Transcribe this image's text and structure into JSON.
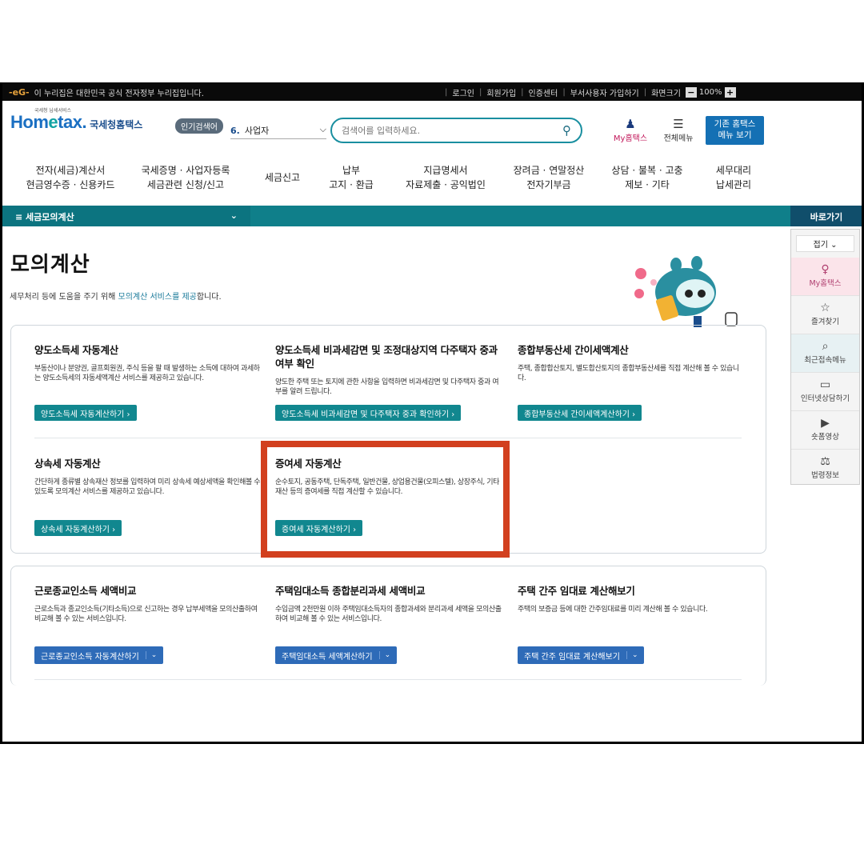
{
  "govbar": {
    "logo": "-eG-",
    "notice": "이 누리집은 대한민국 공식 전자정부 누리집입니다.",
    "links": [
      "로그인",
      "회원가입",
      "인증센터",
      "부서사용자 가입하기",
      "화면크기"
    ],
    "zoom_minus": "−",
    "zoom_value": "100%",
    "zoom_plus": "+"
  },
  "header": {
    "logo_tiny": "국세청 납세서비스",
    "logo_brand_a": "Hom",
    "logo_brand_b": "e",
    "logo_brand_c": "tax.",
    "logo_sub": "국세청홈택스",
    "popular_label": "인기검색어",
    "trend_num": "6.",
    "trend_text": "사업자",
    "trend_arrow": "⌵",
    "search_placeholder": "검색어를 입력하세요.",
    "my_label": "My홈택스",
    "menu_label": "전체메뉴",
    "old_home_line1": "기존 홈택스",
    "old_home_line2": "메뉴 보기"
  },
  "nav": [
    {
      "l1": "전자(세금)계산서",
      "l2": "현금영수증 · 신용카드"
    },
    {
      "l1": "국세증명 · 사업자등록",
      "l2": "세금관련 신청/신고"
    },
    {
      "l1": "세금신고",
      "l2": ""
    },
    {
      "l1": "납부",
      "l2": "고지 · 환급"
    },
    {
      "l1": "지급명세서",
      "l2": "자료제출 · 공익법인"
    },
    {
      "l1": "장려금 · 연말정산",
      "l2": "전자기부금"
    },
    {
      "l1": "상담 · 불복 · 고충",
      "l2": "제보 · 기타"
    },
    {
      "l1": "세무대리",
      "l2": "납세관리"
    }
  ],
  "section": {
    "menu_label": "≡  세금모의계산",
    "menu_arrow": "⌄",
    "quick_title": "바로가기"
  },
  "quick": {
    "fold": "접기 ⌄",
    "items": [
      {
        "icon": "♀",
        "label": "My홈택스"
      },
      {
        "icon": "☆",
        "label": "즐겨찾기"
      },
      {
        "icon": "⌕",
        "label": "최근접속메뉴"
      },
      {
        "icon": "▭",
        "label": "인터넷상담하기"
      },
      {
        "icon": "▶",
        "label": "숏폼영상"
      },
      {
        "icon": "⚖",
        "label": "법령정보"
      }
    ]
  },
  "page": {
    "title": "모의계산",
    "desc_a": "세무처리 등에 도움을 주기 위해 ",
    "desc_hl": "모의계산 서비스를 제공",
    "desc_b": "합니다."
  },
  "calcs": [
    {
      "title": "양도소득세 자동계산",
      "desc": "부동산이나 분양권, 골프회원권, 주식 등을 팔 때 발생하는 소득에 대하여 과세하는 양도소득세의 자동세액계산 서비스를 제공하고 있습니다.",
      "button": "양도소득세 자동계산하기  ›"
    },
    {
      "title": "양도소득세 비과세감면 및 조정대상지역 다주택자 중과 여부 확인",
      "desc": "양도한 주택 또는 토지에 관한 사항을 입력하면 비과세감면 및 다주택자 중과 여부를 알려 드립니다.",
      "button": "양도소득세 비과세감면 및 다주택자 중과 확인하기  ›"
    },
    {
      "title": "종합부동산세 간이세액계산",
      "desc": "주택, 종합합산토지, 별도합산토지의 종합부동산세를 직접 계산해 볼 수 있습니다.",
      "button": "종합부동산세 간이세액계산하기  ›"
    },
    {
      "title": "상속세 자동계산",
      "desc": "간단하게 종류별 상속재산 정보를 입력하여 미리 상속세 예상세액을 확인해볼 수 있도록 모의계산 서비스를 제공하고 있습니다.",
      "button": "상속세 자동계산하기  ›"
    },
    {
      "title": "증여세 자동계산",
      "desc": "순수토지, 공동주택, 단독주택, 일반건물, 상업용건물(오피스텔), 상장주식, 기타재산 등의 증여세를 직접 계산할 수 있습니다.",
      "button": "증여세 자동계산하기  ›"
    },
    {
      "title": "근로종교인소득 세액비교",
      "desc": "근로소득과 종교인소득(기타소득)으로 신고하는 경우 납부세액을 모의산출하여 비교해 볼 수 있는 서비스입니다.",
      "button": "근로종교인소득 자동계산하기"
    },
    {
      "title": "주택임대소득 종합분리과세 세액비교",
      "desc": "수입금액 2천만원 이하 주택임대소득자의 종합과세와 분리과세 세액을 모의산출하여 비교해 볼 수 있는 서비스입니다.",
      "button": "주택임대소득 세액계산하기"
    },
    {
      "title": "주택 간주 임대료 계산해보기",
      "desc": "주택의 보증금 등에 대한 간주임대료를 미리 계산해 볼 수 있습니다.",
      "button": "주택 간주 임대료 계산해보기"
    }
  ],
  "dropdown_glyph": "⌄"
}
